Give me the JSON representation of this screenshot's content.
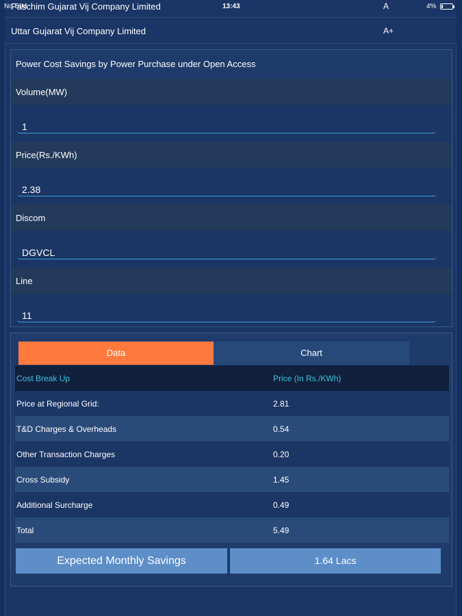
{
  "status_bar": {
    "carrier": "No SIM",
    "time": "13:43",
    "battery": "4%"
  },
  "companies": [
    {
      "name": "Paschim Gujarat Vij Company Limited",
      "font_button": "A"
    },
    {
      "name": "Uttar Gujarat Vij Company Limited",
      "font_button": "A+"
    }
  ],
  "form": {
    "title": "Power Cost Savings by Power Purchase under Open Access",
    "fields": [
      {
        "label": "Volume(MW)",
        "value": "1"
      },
      {
        "label": "Price(Rs./KWh)",
        "value": "2.38"
      },
      {
        "label": "Discom",
        "value": "DGVCL"
      },
      {
        "label": "Line",
        "value": "11"
      }
    ]
  },
  "results": {
    "tabs": {
      "data": "Data",
      "chart": "Chart"
    },
    "active_tab": "Data",
    "colors": {
      "active_tab": "#ff7a3d",
      "header_text": "#3ec5e0"
    },
    "header": {
      "col1": "Cost Break Up",
      "col2": "Price (In Rs./KWh)"
    },
    "rows": [
      {
        "label": "Price at Regional Grid:",
        "value": "2.81"
      },
      {
        "label": "T&D Charges & Overheads",
        "value": "0.54"
      },
      {
        "label": "Other Transaction Charges",
        "value": "0.20"
      },
      {
        "label": "Cross Subsidy",
        "value": "1.45"
      },
      {
        "label": "Additional Surcharge",
        "value": "0.49"
      },
      {
        "label": "Total",
        "value": "5.49"
      }
    ],
    "savings_label": "Expected Monthly Savings",
    "savings_value": "1.64 Lacs"
  }
}
